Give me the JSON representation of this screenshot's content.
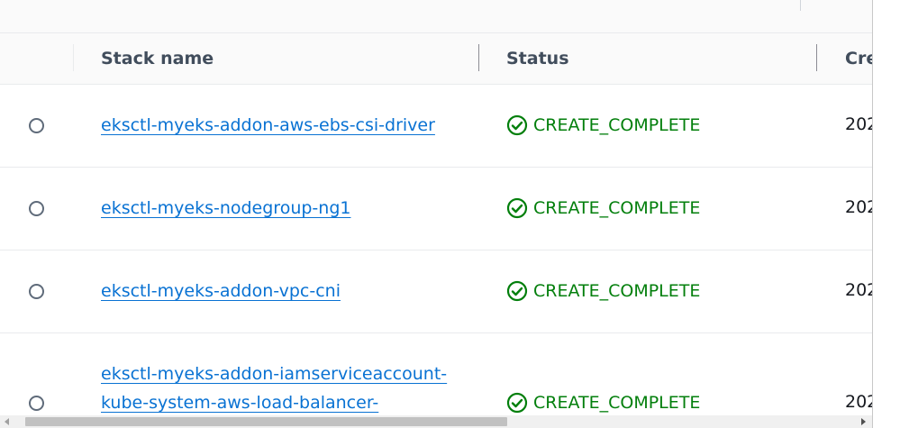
{
  "table": {
    "columns": {
      "stack_name": "Stack name",
      "status": "Status",
      "created": "Cre"
    },
    "rows": [
      {
        "name": "eksctl-myeks-addon-aws-ebs-csi-driver",
        "status": "CREATE_COMPLETE",
        "created": "202"
      },
      {
        "name": "eksctl-myeks-nodegroup-ng1",
        "status": "CREATE_COMPLETE",
        "created": "202"
      },
      {
        "name": "eksctl-myeks-addon-vpc-cni",
        "status": "CREATE_COMPLETE",
        "created": "202"
      },
      {
        "name_line1": "eksctl-myeks-addon-iamserviceaccount-",
        "name_line2": "kube-system-aws-load-balancer-",
        "status": "CREATE_COMPLETE",
        "created": "202"
      }
    ]
  },
  "colors": {
    "link": "#0972d3",
    "success": "#037f0c",
    "header_text": "#414d5c"
  },
  "icons": {
    "status": "check-circle-icon",
    "radio": "radio-button"
  }
}
